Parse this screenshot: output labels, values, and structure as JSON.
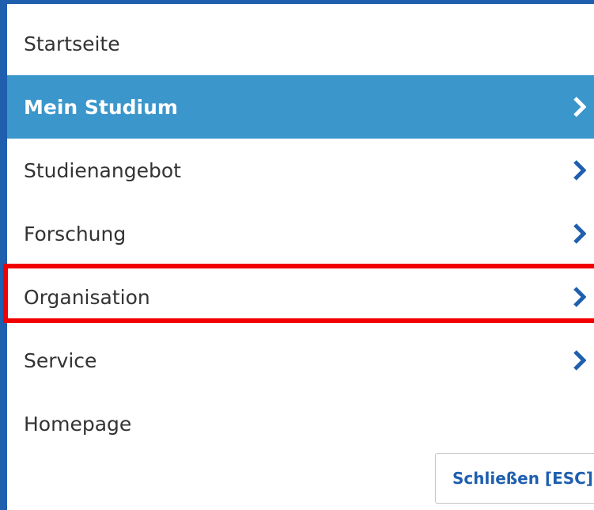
{
  "menu": {
    "items": [
      {
        "label": "Startseite",
        "has_submenu": false,
        "active": false
      },
      {
        "label": "Mein Studium",
        "has_submenu": true,
        "active": true
      },
      {
        "label": "Studienangebot",
        "has_submenu": true,
        "active": false
      },
      {
        "label": "Forschung",
        "has_submenu": true,
        "active": false
      },
      {
        "label": "Organisation",
        "has_submenu": true,
        "active": false,
        "highlighted": true
      },
      {
        "label": "Service",
        "has_submenu": true,
        "active": false
      },
      {
        "label": "Homepage",
        "has_submenu": false,
        "active": false
      }
    ],
    "close_label": "Schließen [ESC]"
  },
  "icons": {
    "submenu": "chevron-right-icon"
  },
  "colors": {
    "panel_border": "#1f5fae",
    "active_background": "#3b96cc",
    "active_text": "#ffffff",
    "chevron": "#1f5fae",
    "highlight": "#f20000"
  }
}
